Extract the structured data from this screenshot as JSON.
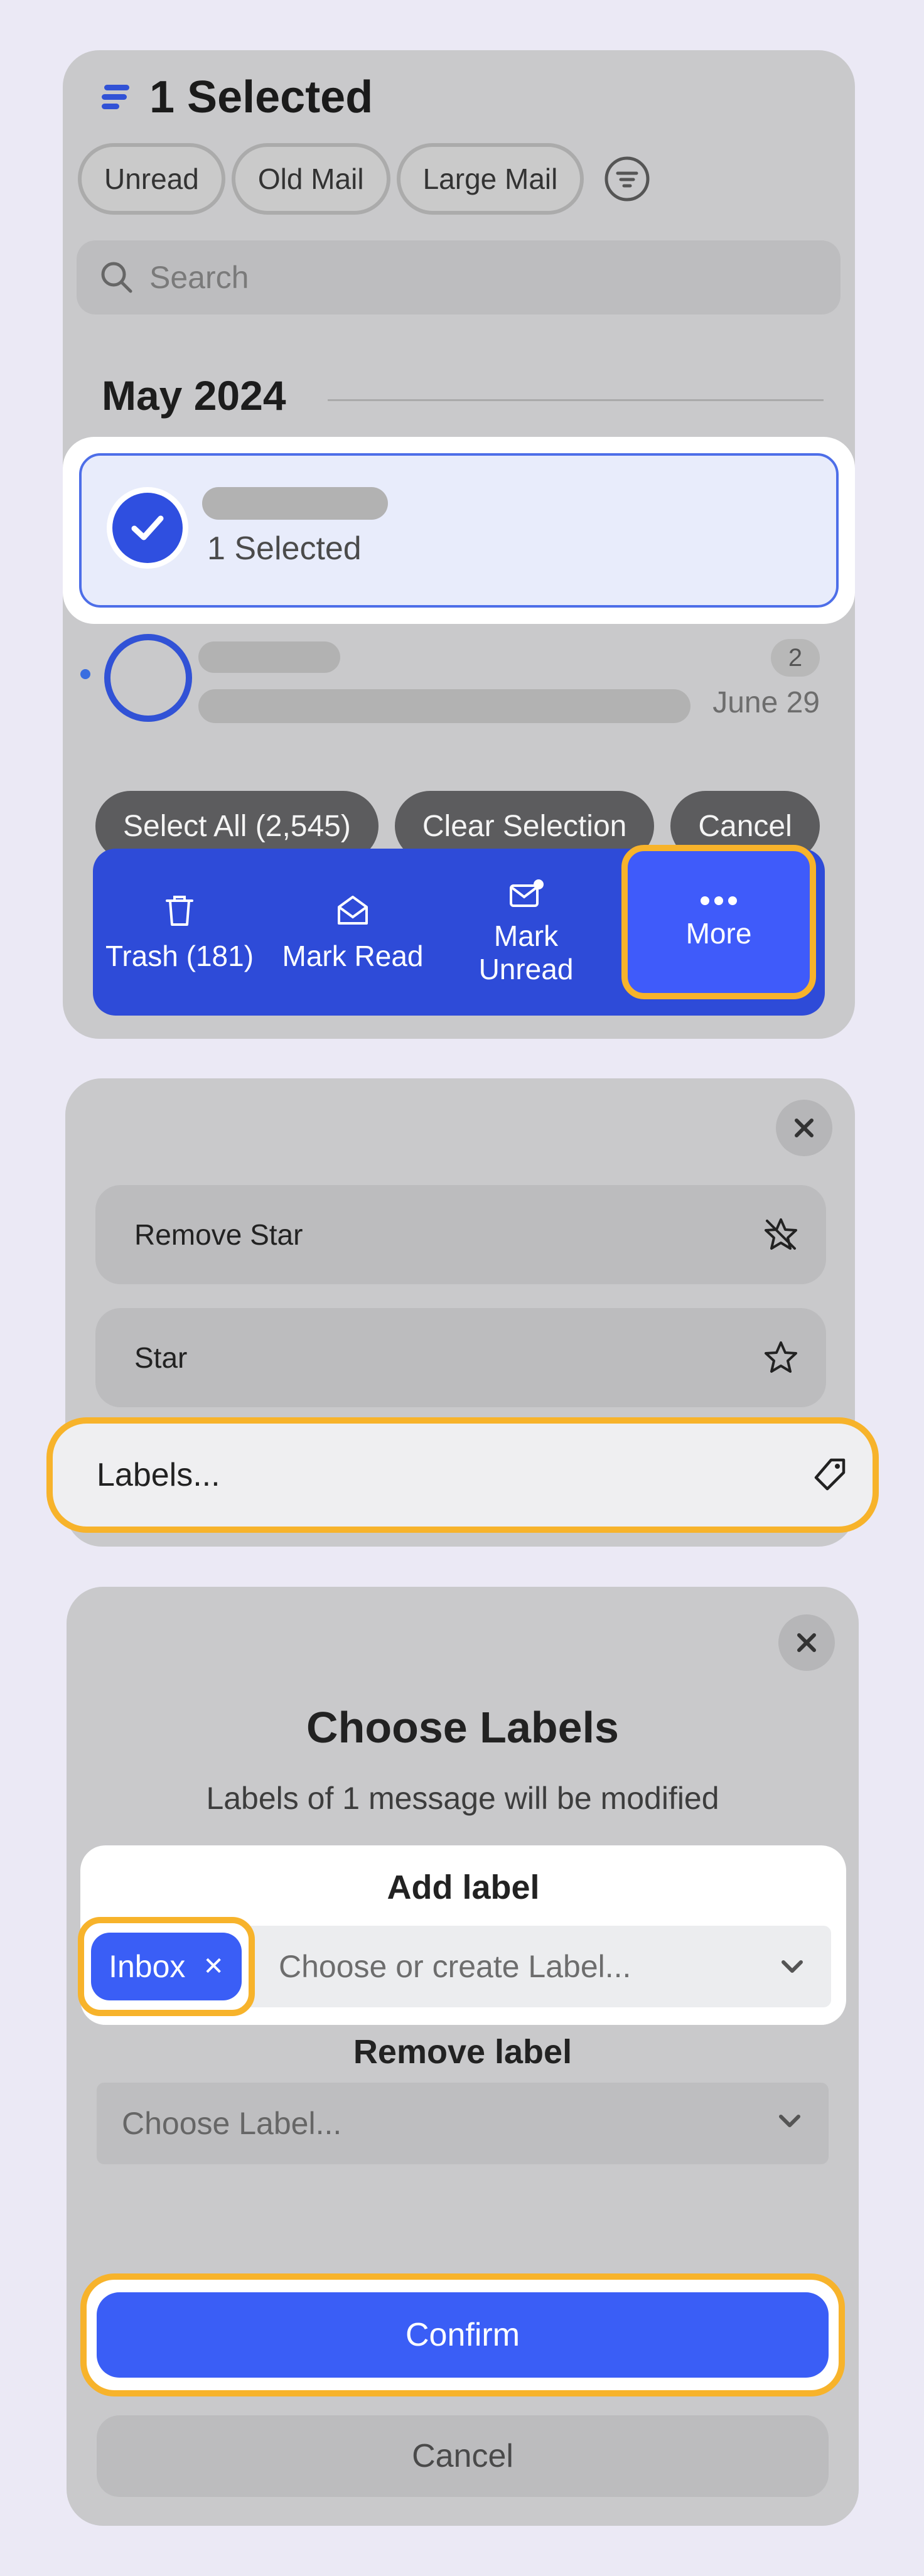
{
  "list_panel": {
    "title": "1 Selected",
    "filters": [
      "Unread",
      "Old Mail",
      "Large Mail"
    ],
    "search_placeholder": "Search",
    "month_header": "May 2024",
    "selected_row": {
      "text": "1 Selected"
    },
    "row": {
      "count_badge": "2",
      "date": "June 29"
    },
    "selection_actions": {
      "select_all": "Select All (2,545)",
      "clear": "Clear Selection",
      "cancel": "Cancel"
    },
    "toolbar": {
      "trash": "Trash (181)",
      "mark_read": "Mark Read",
      "mark_unread_line1": "Mark",
      "mark_unread_line2": "Unread",
      "more": "More"
    }
  },
  "more_menu": {
    "items": [
      "Remove Star",
      "Star",
      "Labels..."
    ]
  },
  "labels_dialog": {
    "title": "Choose Labels",
    "subtitle": "Labels of 1 message will be modified",
    "add_label_title": "Add label",
    "selected_tag": "Inbox",
    "add_placeholder": "Choose or create Label...",
    "remove_label_title": "Remove label",
    "remove_placeholder": "Choose Label...",
    "confirm": "Confirm",
    "cancel": "Cancel"
  },
  "colors": {
    "accent": "#3a5ef6",
    "toolbar": "#2e4bd8",
    "highlight": "#f7b32b",
    "panel": "#c9c9cb"
  }
}
